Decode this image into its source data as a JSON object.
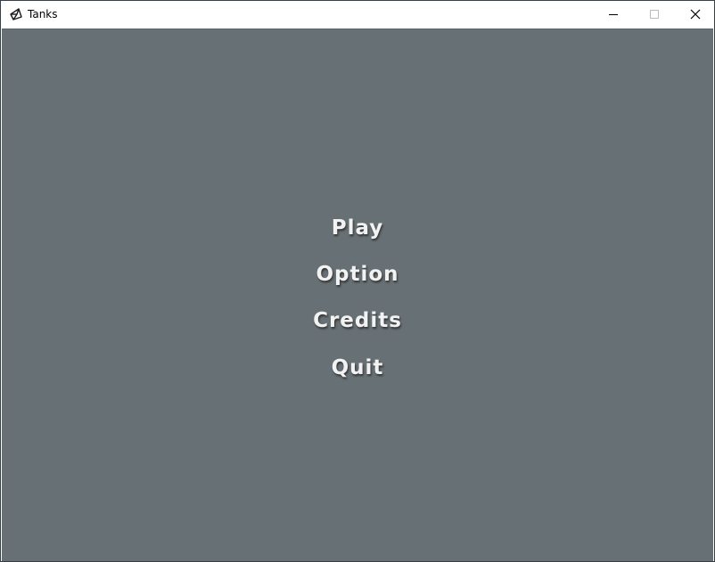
{
  "window": {
    "title": "Tanks",
    "app_icon": "unity-icon",
    "controls": {
      "minimize": "minimize-icon",
      "maximize": "maximize-icon",
      "close": "close-icon"
    }
  },
  "main_menu": {
    "items": [
      {
        "label": "Play"
      },
      {
        "label": "Option"
      },
      {
        "label": "Credits"
      },
      {
        "label": "Quit"
      }
    ]
  },
  "colors": {
    "background": "#677074",
    "menu_text": "#f2f2f2"
  }
}
